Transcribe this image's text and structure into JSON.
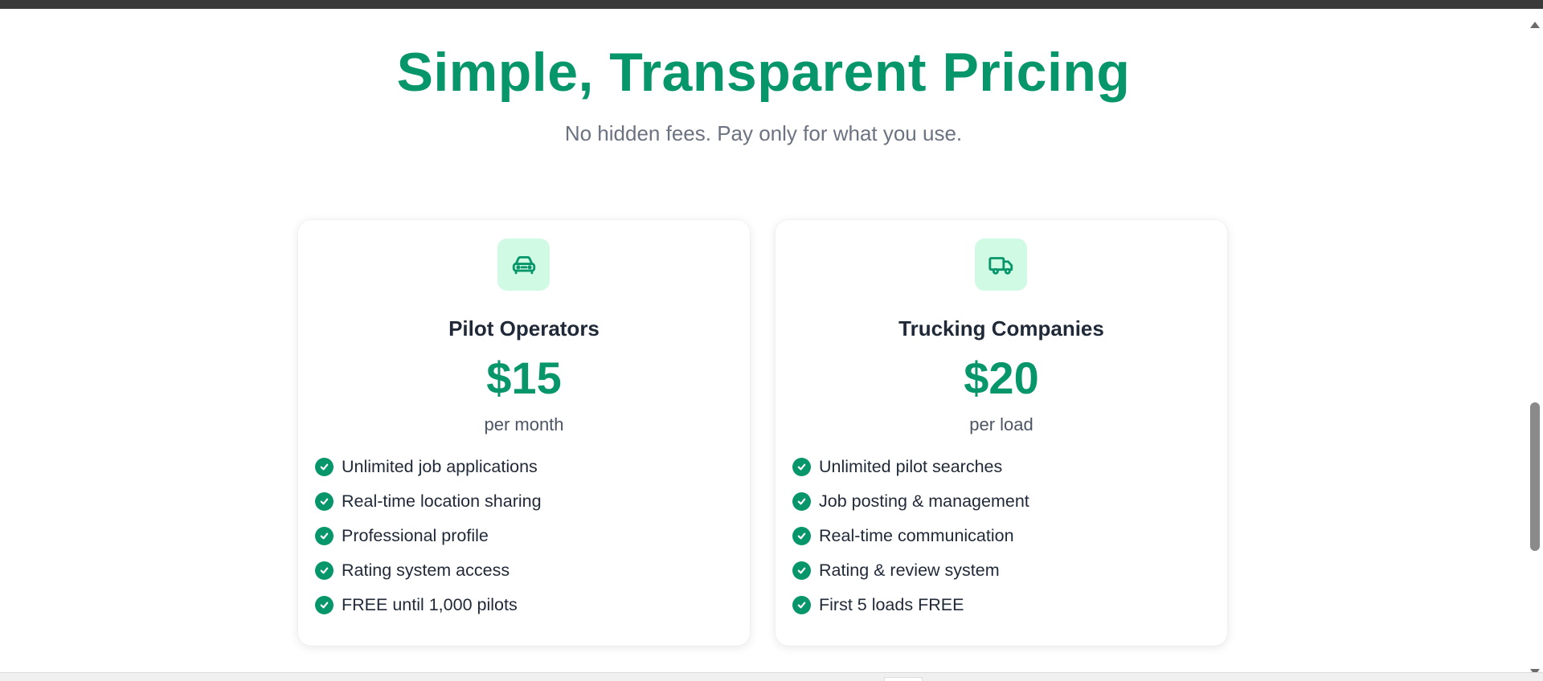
{
  "pricing": {
    "title": "Simple, Transparent Pricing",
    "subtitle": "No hidden fees. Pay only for what you use."
  },
  "colors": {
    "accent": "#07966a",
    "icon_bg": "#d1fae5",
    "text_dark": "#1f2937",
    "text_muted": "#6b7280"
  },
  "plans": [
    {
      "icon": "car-icon",
      "title": "Pilot Operators",
      "price": "$15",
      "period": "per month",
      "features": [
        "Unlimited job applications",
        "Real-time location sharing",
        "Professional profile",
        "Rating system access",
        "FREE until 1,000 pilots"
      ]
    },
    {
      "icon": "truck-icon",
      "title": "Trucking Companies",
      "price": "$20",
      "period": "per load",
      "features": [
        "Unlimited pilot searches",
        "Job posting & management",
        "Real-time communication",
        "Rating & review system",
        "First 5 loads FREE"
      ]
    }
  ]
}
